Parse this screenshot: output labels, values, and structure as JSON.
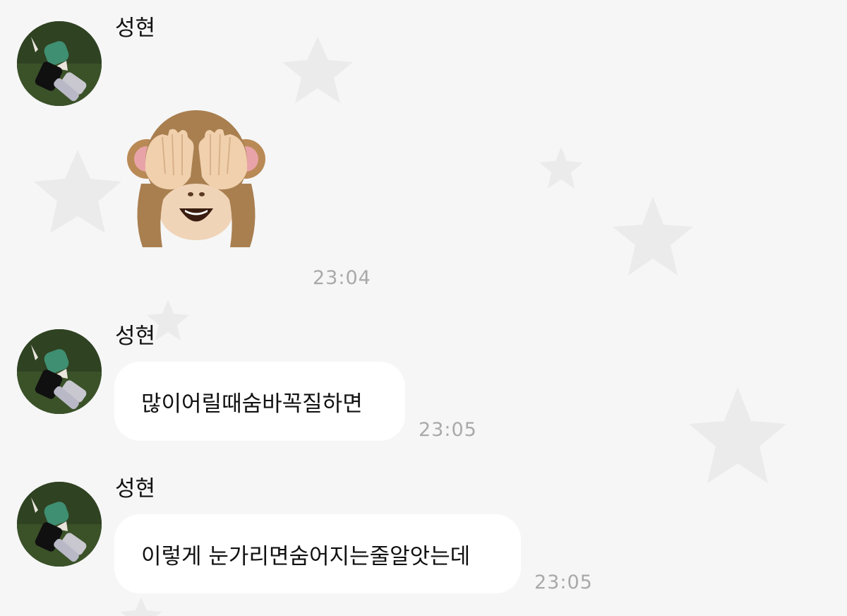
{
  "chat": {
    "messages": [
      {
        "sender": "성현",
        "sticker": "see-no-evil-monkey",
        "time": "23:04"
      },
      {
        "sender": "성현",
        "text": "많이어릴때숨바꼭질하면",
        "time": "23:05"
      },
      {
        "sender": "성현",
        "text": "이렇게 눈가리면숨어지는줄알앗는데",
        "time": "23:05"
      }
    ]
  },
  "theme": {
    "background": "#f6f6f6",
    "star_color": "#ebebeb",
    "bubble": "#ffffff",
    "timestamp_color": "#a9a9a9"
  }
}
